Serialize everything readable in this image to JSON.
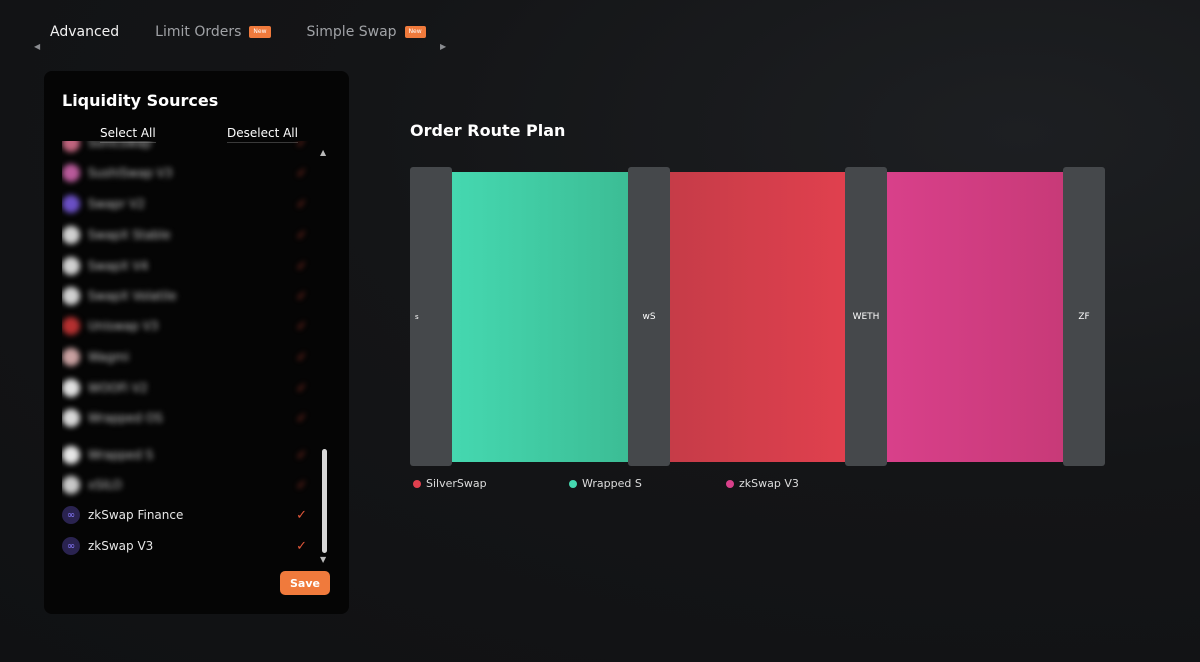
{
  "tabs": [
    {
      "label": "Advanced",
      "badge": ""
    },
    {
      "label": "Limit Orders",
      "badge": "New"
    },
    {
      "label": "Simple Swap",
      "badge": "New"
    }
  ],
  "liquidity": {
    "title": "Liquidity Sources",
    "select_all": "Select All",
    "deselect_all": "Deselect All",
    "save_label": "Save",
    "sources": [
      {
        "name": "Sonicswap",
        "selected": true,
        "blurred": true,
        "logo_color": "#c0647e"
      },
      {
        "name": "SushiSwap V3",
        "selected": true,
        "blurred": true,
        "logo_color": "#b85a9a"
      },
      {
        "name": "Swapr V2",
        "selected": true,
        "blurred": true,
        "logo_color": "#6a4fc4"
      },
      {
        "name": "SwapX Stable",
        "selected": true,
        "blurred": true,
        "logo_color": "#d0d0d0"
      },
      {
        "name": "SwapX V4",
        "selected": true,
        "blurred": true,
        "logo_color": "#d0d0d0"
      },
      {
        "name": "SwapX Volatile",
        "selected": true,
        "blurred": true,
        "logo_color": "#d0d0d0"
      },
      {
        "name": "Uniswap V3",
        "selected": true,
        "blurred": true,
        "logo_color": "#b43030"
      },
      {
        "name": "Wagmi",
        "selected": true,
        "blurred": true,
        "logo_color": "#c8a0a0"
      },
      {
        "name": "WOOFi V2",
        "selected": true,
        "blurred": true,
        "logo_color": "#e0e0e0"
      },
      {
        "name": "Wrapped OS",
        "selected": true,
        "blurred": true,
        "logo_color": "#d8d8d8"
      },
      {
        "name": "Wrapped S",
        "selected": true,
        "blurred": true,
        "logo_color": "#e6e6e6"
      },
      {
        "name": "xSILO",
        "selected": true,
        "blurred": true,
        "logo_color": "#c8c8c8"
      },
      {
        "name": "zkSwap Finance",
        "selected": true,
        "blurred": false,
        "logo_color": "#2a2350"
      },
      {
        "name": "zkSwap V3",
        "selected": true,
        "blurred": false,
        "logo_color": "#2a2350"
      }
    ],
    "check_icon": "check-icon",
    "colors": {
      "accent": "#f07a3c",
      "check": "#e0573a"
    }
  },
  "route": {
    "title": "Order Route Plan",
    "nodes": [
      "s",
      "wS",
      "WETH",
      "ZF"
    ],
    "flows": [
      {
        "color_from": "#45d8b0",
        "color_to": "#3cbd95"
      },
      {
        "color_from": "#c63c48",
        "color_to": "#e0404e"
      },
      {
        "color_from": "#d8408a",
        "color_to": "#c83a78"
      }
    ],
    "legend": [
      {
        "label": "SilverSwap",
        "color": "#e0404e"
      },
      {
        "label": "Wrapped S",
        "color": "#45d8b0"
      },
      {
        "label": "zkSwap V3",
        "color": "#d8408a"
      }
    ]
  }
}
